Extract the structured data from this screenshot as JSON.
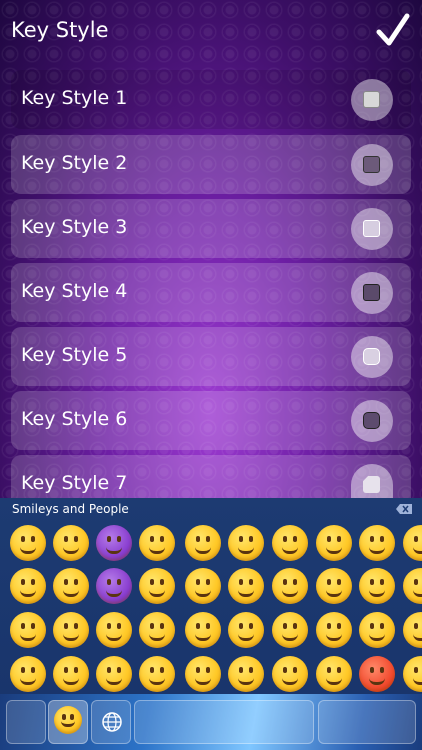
{
  "header": {
    "title": "Key Style",
    "done_icon": "checkmark-icon"
  },
  "styles": [
    {
      "label": "Key Style 1",
      "swatch": "#d7d7d7"
    },
    {
      "label": "Key Style 2",
      "swatch": "#6c5a7a"
    },
    {
      "label": "Key Style 3",
      "swatch": "#d6cde0"
    },
    {
      "label": "Key Style 4",
      "swatch": "#5b4a6b"
    },
    {
      "label": "Key Style 5",
      "swatch": "#d9d0e2"
    },
    {
      "label": "Key Style 6",
      "swatch": "#5d4b6e"
    },
    {
      "label": "Key Style 7",
      "swatch": "#e7e2ec"
    }
  ],
  "keyboard": {
    "category": "Smileys and People",
    "delete_icon": "delete-icon",
    "globe_icon": "globe-icon",
    "smiley_tab_icon": "smiley-icon"
  },
  "colors": {
    "accent": "#8a3fd0",
    "keyboard_bg": "#1d3b72"
  }
}
